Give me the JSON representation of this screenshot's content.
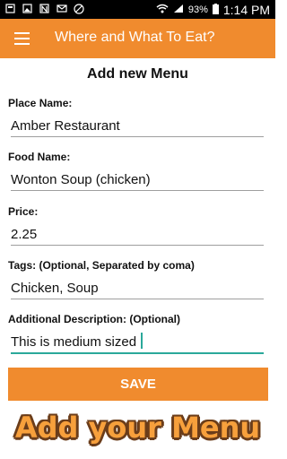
{
  "status_bar": {
    "battery_percent": "93%",
    "time": "1:14 PM",
    "icons": [
      "notification-icon",
      "image-icon",
      "n-app-icon",
      "mail-icon",
      "blocked-icon",
      "wifi-icon",
      "signal-icon",
      "battery-icon"
    ]
  },
  "app_bar": {
    "title": "Where and What To Eat?",
    "menu_icon": "hamburger-menu-icon",
    "color": "#f08b2e"
  },
  "form": {
    "title": "Add new Menu",
    "place_name": {
      "label": "Place Name:",
      "value": "Amber Restaurant"
    },
    "food_name": {
      "label": "Food Name:",
      "value": "Wonton Soup (chicken)"
    },
    "price": {
      "label": "Price:",
      "value": "2.25"
    },
    "tags": {
      "label": "Tags: (Optional, Separated by coma)",
      "value": "Chicken, Soup"
    },
    "description": {
      "label": "Additional Description: (Optional)",
      "value": "This is medium sized"
    },
    "save_label": "SAVE",
    "accent_color": "#2aa89a"
  },
  "banner": {
    "text": "Add your Menu"
  }
}
